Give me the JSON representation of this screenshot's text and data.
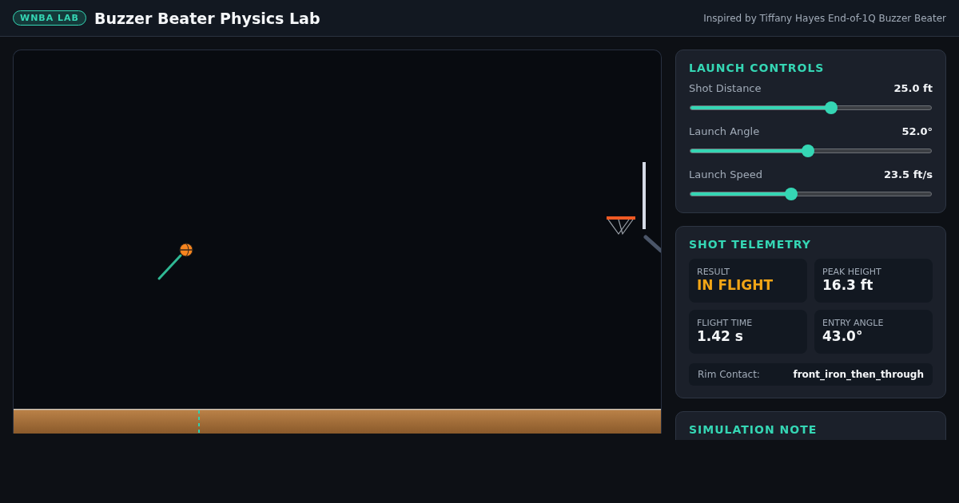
{
  "header": {
    "badge": "WNBA LAB",
    "title": "Buzzer Beater Physics Lab",
    "subtitle": "Inspired by Tiffany Hayes End-of-1Q Buzzer Beater"
  },
  "controls": {
    "title": "LAUNCH CONTROLS",
    "sliders": [
      {
        "label": "Shot Distance",
        "reading": "25.0 ft",
        "level": 0.585
      },
      {
        "label": "Launch Angle",
        "reading": "52.0°",
        "level": 0.49
      },
      {
        "label": "Launch Speed",
        "reading": "23.5 ft/s",
        "level": 0.42
      }
    ]
  },
  "telemetry": {
    "title": "SHOT TELEMETRY",
    "stats": [
      {
        "label": "RESULT",
        "value": "IN FLIGHT",
        "kind": "status"
      },
      {
        "label": "PEAK HEIGHT",
        "value": "16.3 ft",
        "kind": "metric"
      },
      {
        "label": "FLIGHT TIME",
        "value": "1.42 s",
        "kind": "metric"
      },
      {
        "label": "ENTRY ANGLE",
        "value": "43.0°",
        "kind": "metric"
      }
    ],
    "rim_contact": {
      "label": "Rim Contact:",
      "value": "front_iron_then_through"
    }
  },
  "note": {
    "title": "SIMULATION NOTE"
  }
}
